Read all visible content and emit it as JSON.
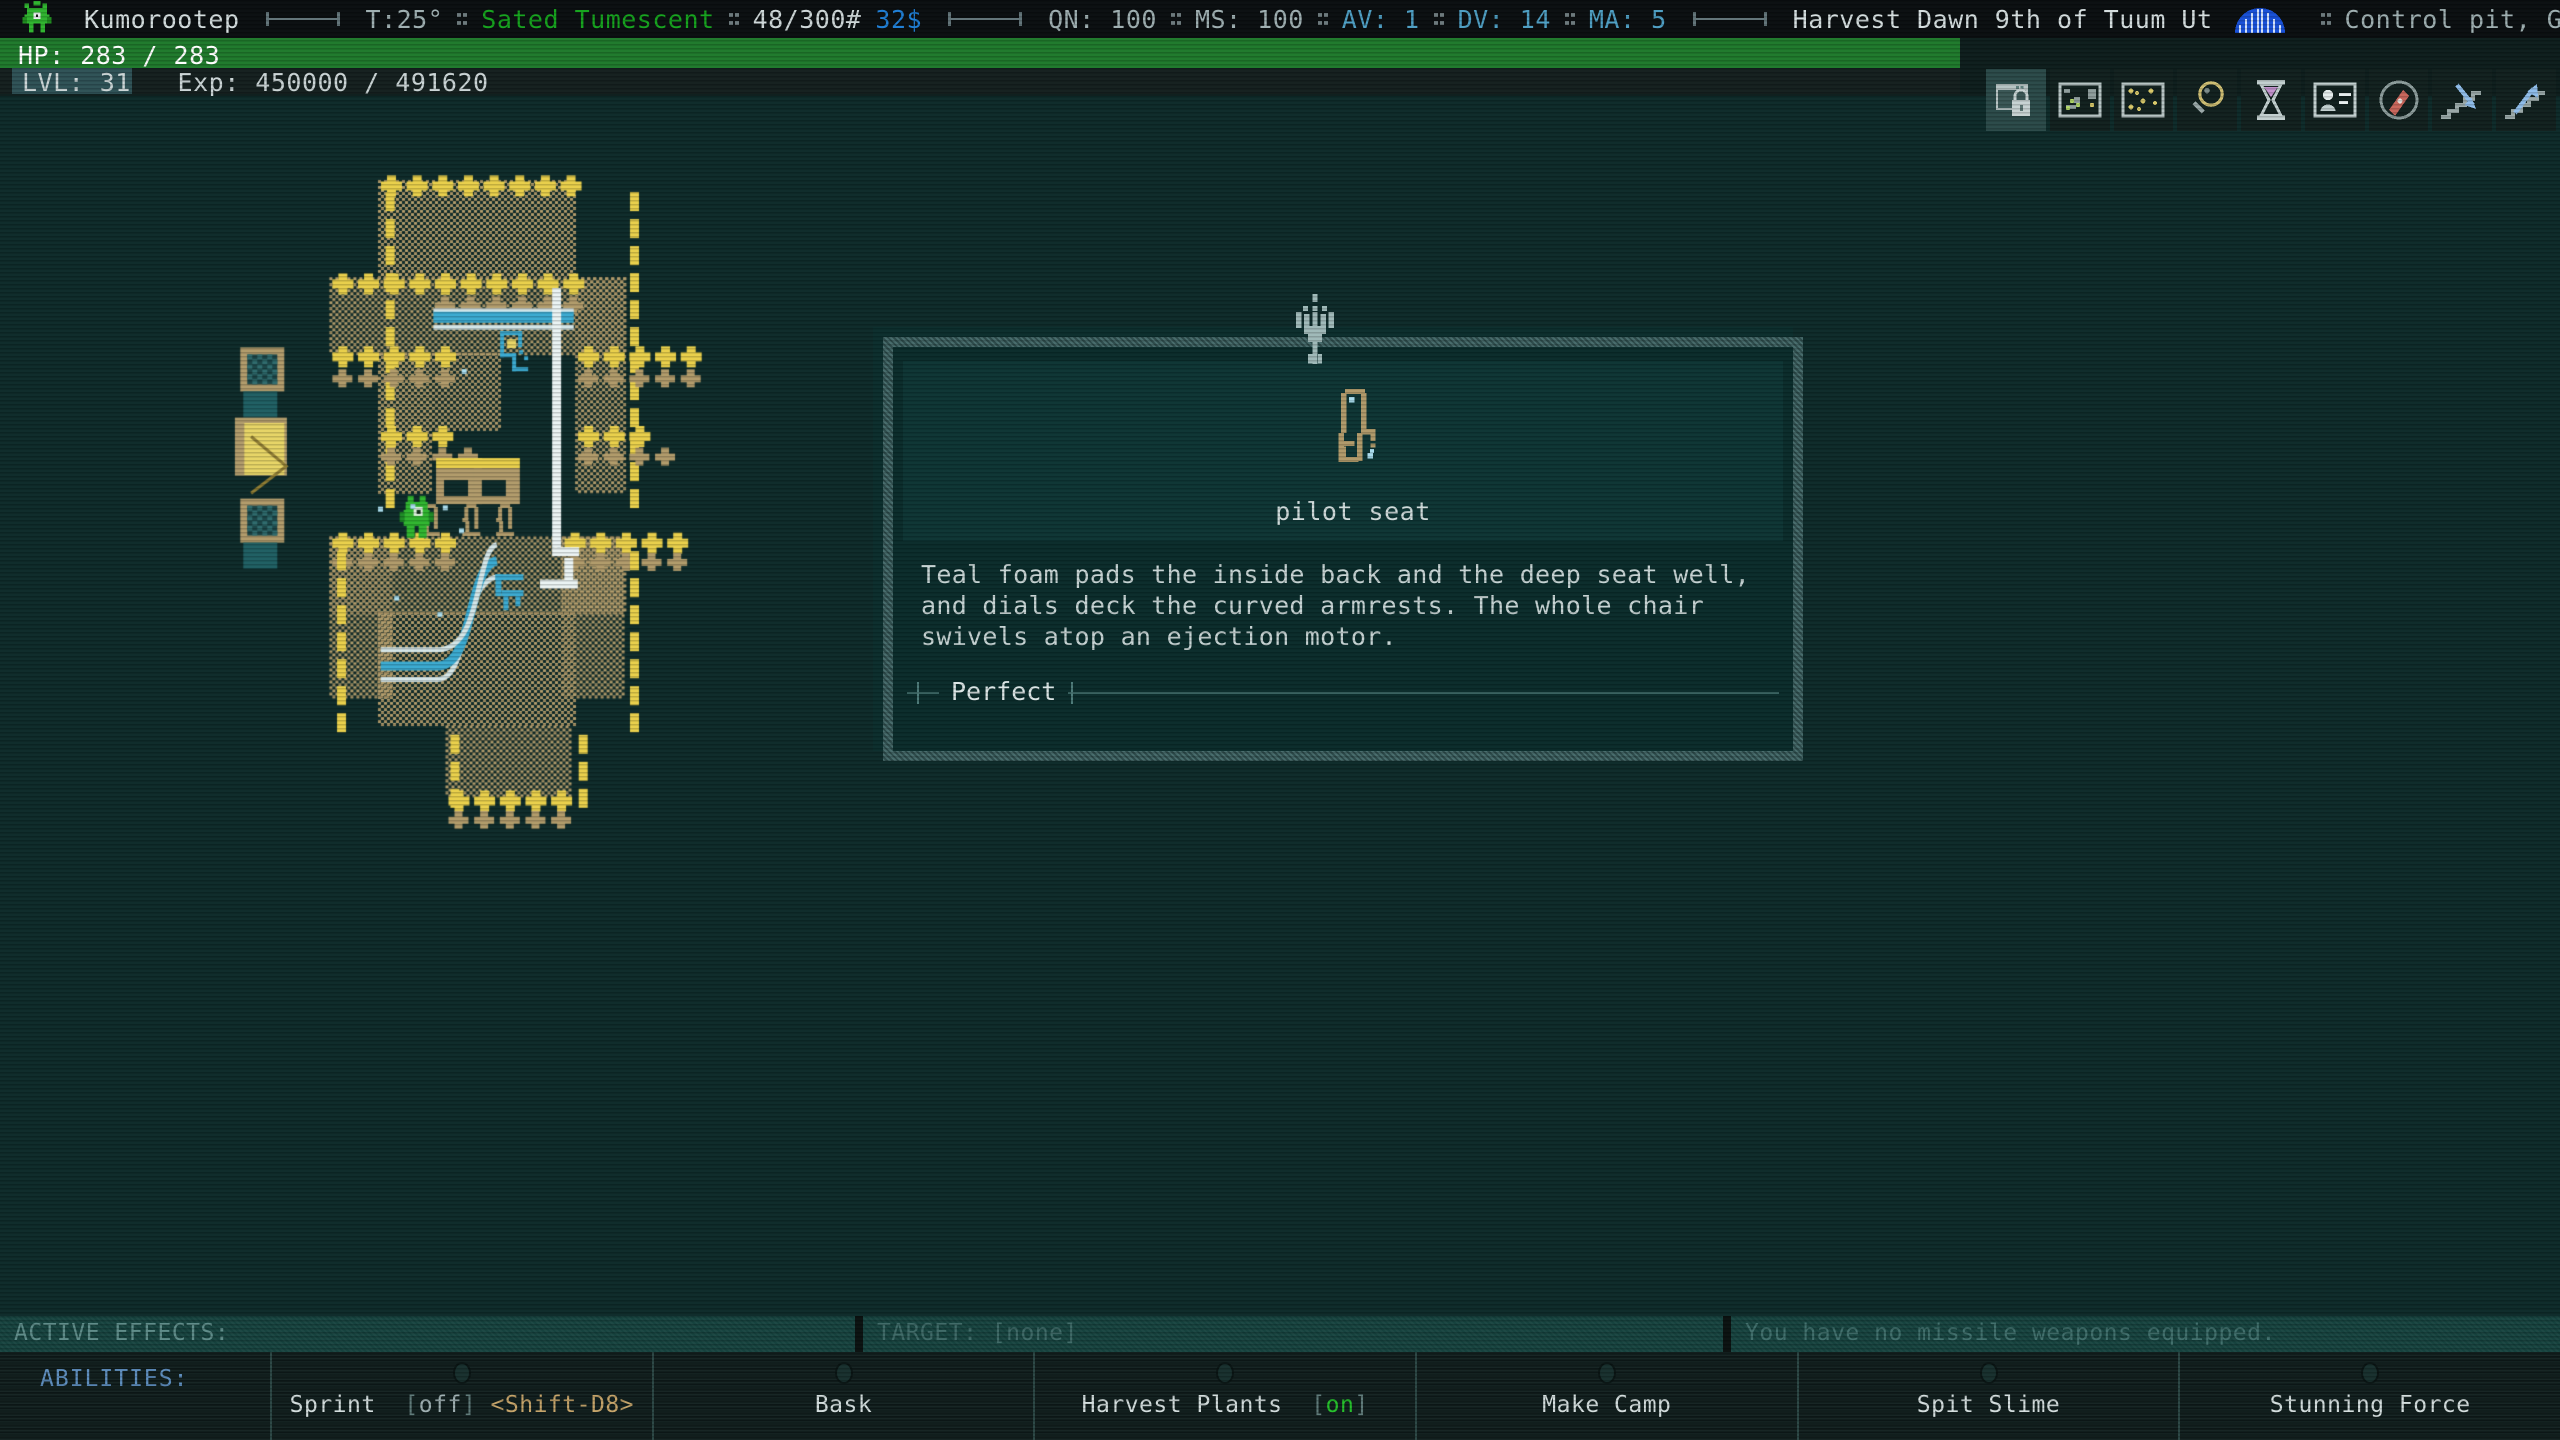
{
  "header": {
    "character_name": "Kumorootep",
    "temperature": "T:25°",
    "status_effects": "Sated Tumescent",
    "weight": "48/300#",
    "money": "32$",
    "qn": "QN: 100",
    "ms": "MS: 100",
    "av": "AV: 1",
    "dv": "DV: 14",
    "ma": "MA: 5",
    "date": "Harvest Dawn 9th of Tuum Ut",
    "location": "Control pit, Golem",
    "avatar_icon": "player-avatar-icon",
    "brain_icon": "brain-icon"
  },
  "status": {
    "hp_text": "HP: 283 / 283",
    "hp_current": 283,
    "hp_max": 283,
    "hp_percent": 100,
    "level_text": "LVL: 31",
    "exp_text": "Exp: 450000 / 491620",
    "exp_current": 450000,
    "exp_max": 491620
  },
  "toolbar": {
    "buttons": [
      {
        "name": "window-lock-icon",
        "label": "Interface lock",
        "selected": true
      },
      {
        "name": "local-map-icon",
        "label": "Local map",
        "selected": false
      },
      {
        "name": "world-map-icon",
        "label": "World map",
        "selected": false
      },
      {
        "name": "magnifier-icon",
        "label": "Look",
        "selected": false
      },
      {
        "name": "hourglass-icon",
        "label": "Wait",
        "selected": false
      },
      {
        "name": "character-sheet-icon",
        "label": "Character",
        "selected": false
      },
      {
        "name": "compass-icon",
        "label": "Journal",
        "selected": false
      },
      {
        "name": "stairs-down-icon",
        "label": "Go down",
        "selected": false
      },
      {
        "name": "stairs-up-icon",
        "label": "Go up",
        "selected": false
      }
    ]
  },
  "popup": {
    "object_name": "pilot seat",
    "description": "Teal foam pads the inside back and the deep seat well, and dials deck the curved armrests. The whole chair swivels atop an ejection motor.",
    "quality": "Perfect",
    "sprite_icon": "pilot-seat-sprite",
    "crown_icon": "wilted-sprout-icon"
  },
  "bottom": {
    "active_effects_label": "ACTIVE EFFECTS:",
    "target_label": "TARGET: [none]",
    "message": "You have no missile weapons equipped.",
    "abilities_label": "ABILITIES:",
    "abilities": [
      {
        "name": "Sprint",
        "state": "off",
        "key": "<Shift-D8>"
      },
      {
        "name": "Bask",
        "state": "",
        "key": ""
      },
      {
        "name": "Harvest Plants",
        "state": "on",
        "key": ""
      },
      {
        "name": "Make Camp",
        "state": "",
        "key": ""
      },
      {
        "name": "Spit Slime",
        "state": "",
        "key": ""
      },
      {
        "name": "Stunning Force",
        "state": "",
        "key": ""
      }
    ]
  },
  "colors": {
    "hp_bar": "#1f7a2c",
    "status_green": "#16a41e",
    "money_blue": "#1f7fd6",
    "stat_cyan": "#4e9fc4",
    "background": "#0e2b2a",
    "wall_tan": "#b09a6a",
    "wall_gold": "#e8cf4a",
    "player_green": "#2fb52f",
    "water_blue": "#3aa9d0",
    "toolbar_selected": "#2b4a49"
  },
  "map": {
    "player_icon": "player-character-sprite",
    "tiles_description": "ruined facility floor plan with gold-trimmed walls, water channels, chairs and consoles"
  }
}
